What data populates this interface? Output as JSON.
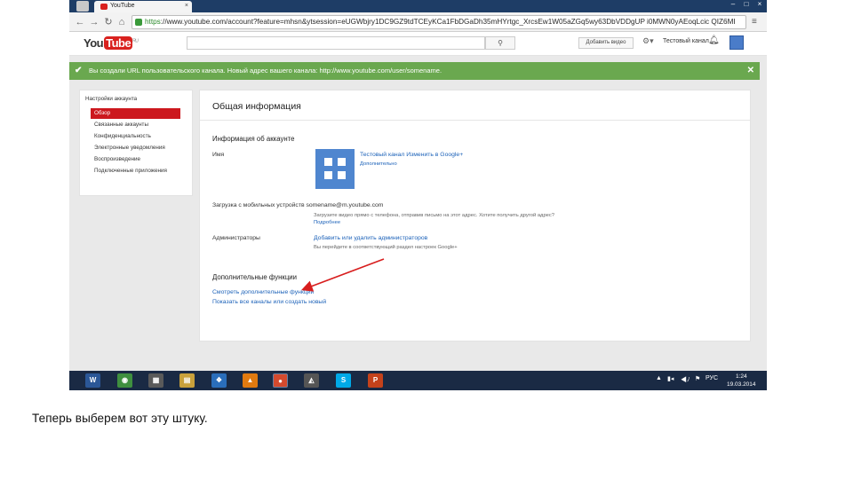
{
  "browser": {
    "tab_title": "YouTube",
    "url_scheme": "https",
    "url_rest": "://www.youtube.com/account?feature=mhsn&ytsession=eUGWbjry1DC9GZ9tdTCEyKCa1FbDGaDh35mHYrtgc_XrcsEw1W05aZGq5wy63DbVDDgUP i0MWN0yAEoqLcic QIZ6MI",
    "window_buttons": [
      "–",
      "□",
      "×"
    ]
  },
  "youtube_header": {
    "logo_you": "You",
    "logo_tube": "Tube",
    "logo_region": "RU",
    "search_placeholder": "",
    "add_video_label": "Добавить видео",
    "channel_name": "Тестовый канал"
  },
  "notice": {
    "check": "✔",
    "text": "Вы создали URL пользовательского канала. Новый адрес вашего канала: http://www.youtube.com/user/somename.",
    "close": "✕"
  },
  "left_nav": {
    "title": "Настройки аккаунта",
    "items": [
      {
        "label": "Обзор",
        "active": true
      },
      {
        "label": "Связанные аккаунты",
        "active": false
      },
      {
        "label": "Конфиденциальность",
        "active": false
      },
      {
        "label": "Электронные уведомления",
        "active": false
      },
      {
        "label": "Воспроизведение",
        "active": false
      },
      {
        "label": "Подключенные приложения",
        "active": false
      }
    ]
  },
  "main": {
    "page_title": "Общая информация",
    "account_section": "Информация об аккаунте",
    "name_label": "Имя",
    "channel_link": "Тестовый канал  Изменить в Google+",
    "channel_sub": "Дополнительно",
    "mobile_label": "Загрузка с мобильных устройств  somename@m.youtube.com",
    "mobile_note": "Загрузите видео прямо с телефона, отправив письмо на этот адрес. Хотите получить другой адрес?",
    "mobile_link": "Подробнее",
    "admin_label": "Администраторы",
    "admin_link": "Добавить или удалить администраторов",
    "admin_note": "Вы перейдете в соответствующий раздел настроек Google+",
    "extra_section": "Дополнительные функции",
    "extra_link1": "Смотреть дополнительные функции",
    "extra_link2": "Показать все каналы или создать новый"
  },
  "taskbar": {
    "apps": [
      {
        "name": "word-icon",
        "glyph": "W",
        "color": "#2b5797"
      },
      {
        "name": "greenshot-icon",
        "glyph": "◉",
        "color": "#3f8f3f"
      },
      {
        "name": "calculator-icon",
        "glyph": "▦",
        "color": "#5a5a5a"
      },
      {
        "name": "explorer-icon",
        "glyph": "▤",
        "color": "#c9a13b"
      },
      {
        "name": "settings-icon",
        "glyph": "❖",
        "color": "#2a6ebb"
      },
      {
        "name": "aimp-icon",
        "glyph": "▲",
        "color": "#e07a10"
      },
      {
        "name": "chrome-icon",
        "glyph": "●",
        "color": "#d44a2e"
      },
      {
        "name": "vlc-icon",
        "glyph": "◭",
        "color": "#555555"
      },
      {
        "name": "skype-icon",
        "glyph": "S",
        "color": "#00a9e8"
      },
      {
        "name": "powerpoint-icon",
        "glyph": "P",
        "color": "#c4421b"
      }
    ],
    "lang": "РУС",
    "time": "1:24",
    "date": "19.03.2014"
  },
  "caption": "Теперь выберем вот эту штуку."
}
